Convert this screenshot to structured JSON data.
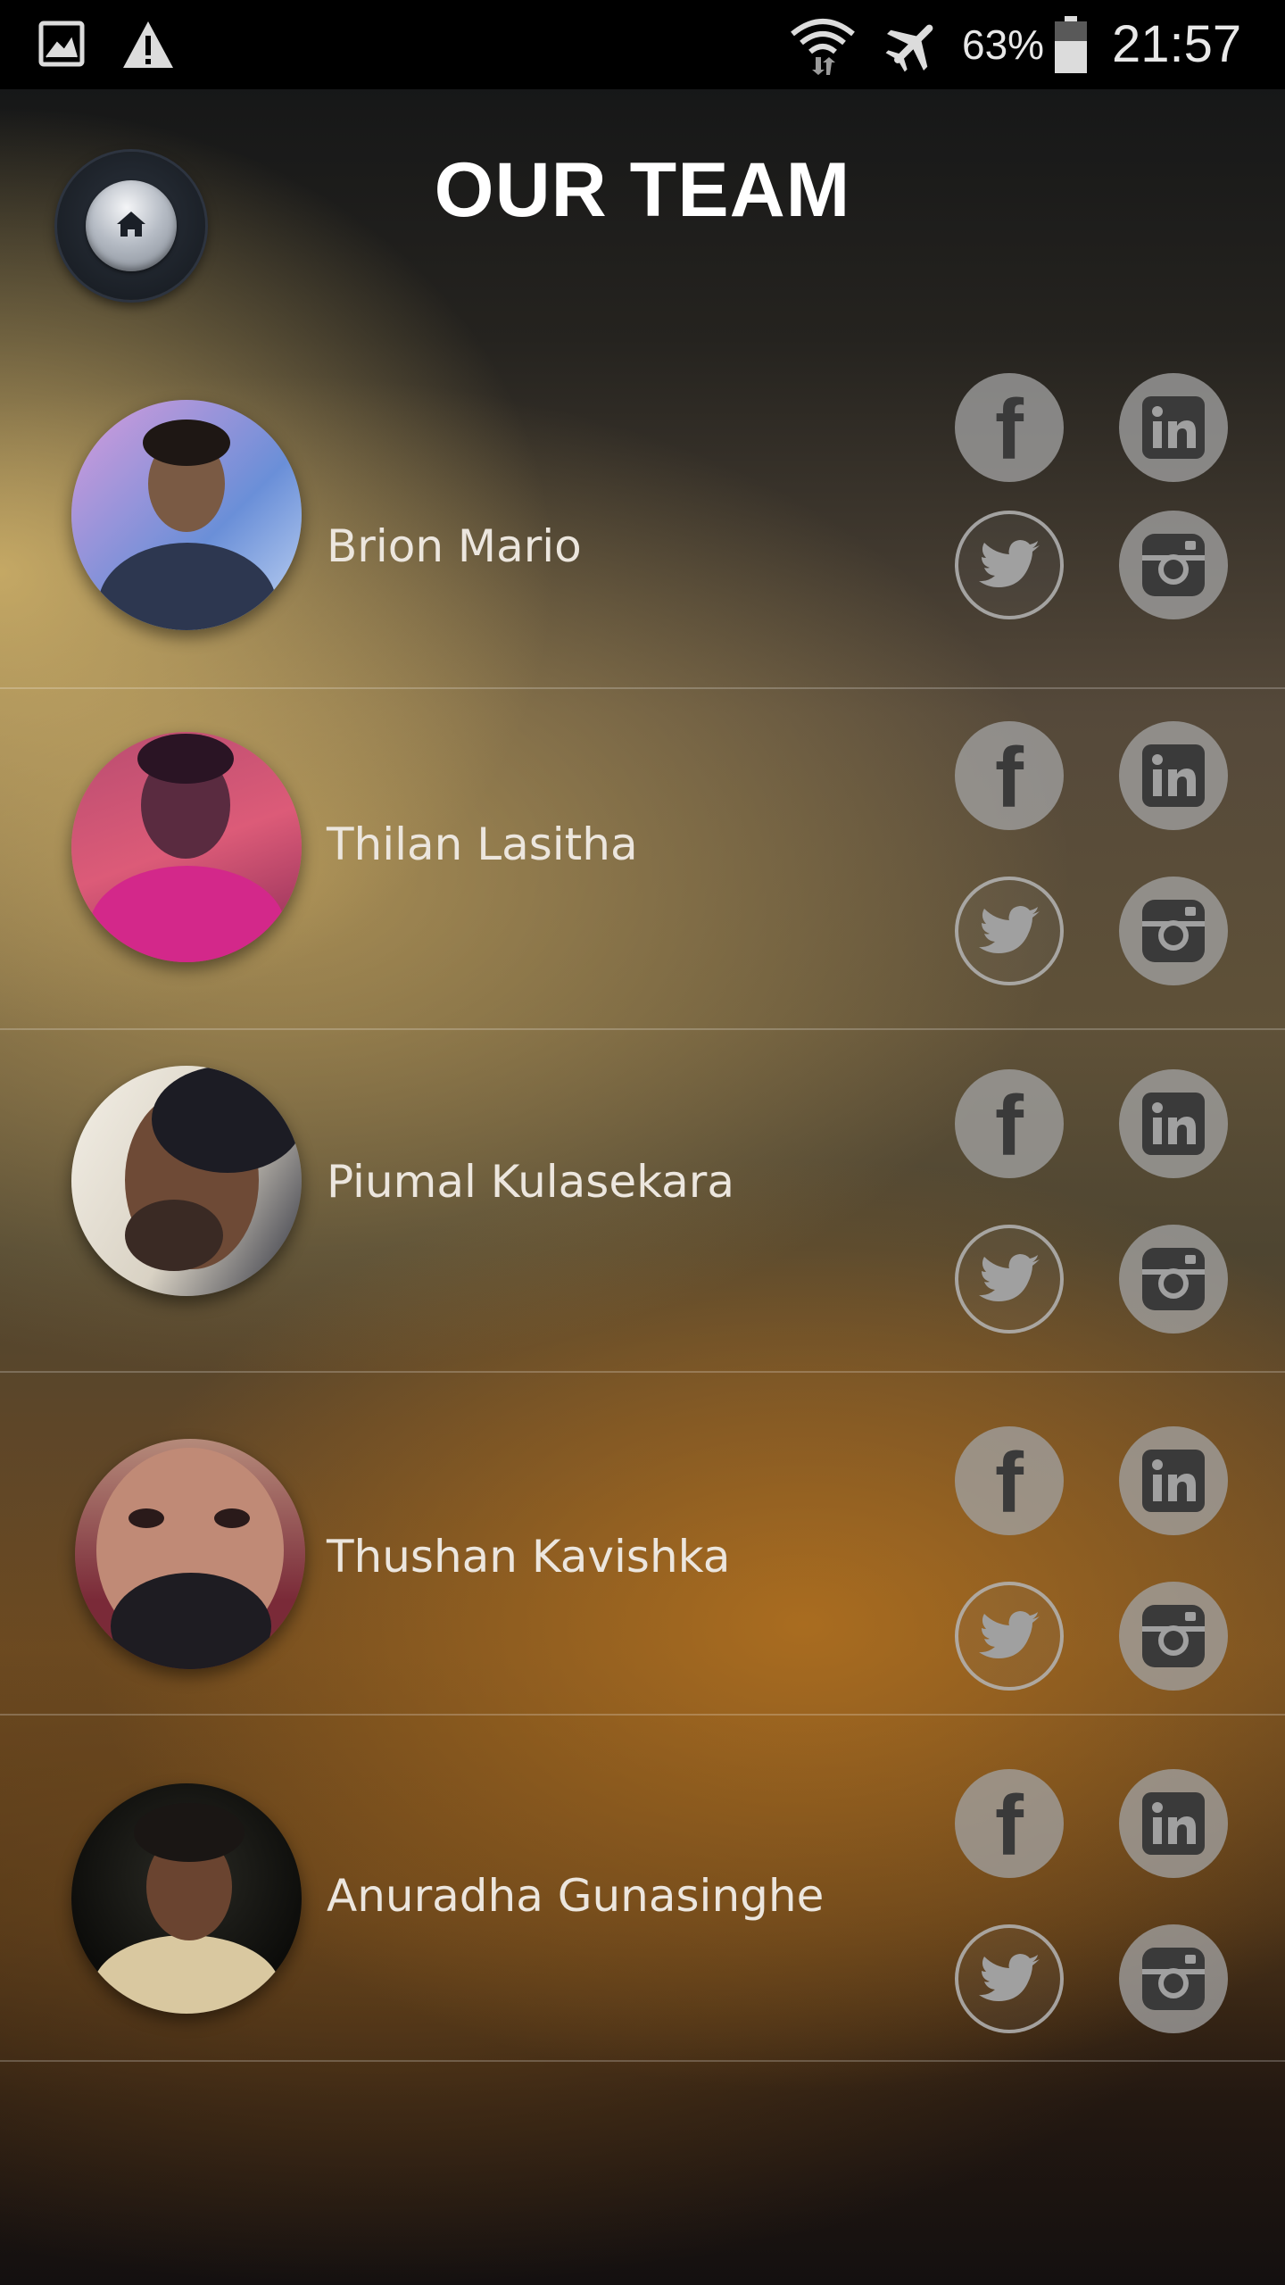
{
  "status_bar": {
    "battery_percent": "63%",
    "time": "21:57",
    "icons": [
      "gallery-icon",
      "warning-icon",
      "wifi-icon",
      "airplane-mode-icon",
      "battery-icon"
    ]
  },
  "header": {
    "title": "OUR TEAM",
    "home_icon": "home-icon"
  },
  "team": [
    {
      "name": "Brion Mario",
      "social": [
        "facebook-icon",
        "linkedin-icon",
        "twitter-icon",
        "instagram-icon"
      ],
      "avatar_colors": [
        "#c98fd0",
        "#3a2a22",
        "#2d3750"
      ]
    },
    {
      "name": "Thilan Lasitha",
      "social": [
        "facebook-icon",
        "linkedin-icon",
        "twitter-icon",
        "instagram-icon"
      ],
      "avatar_colors": [
        "#c2446c",
        "#3a1c2e",
        "#d3288a"
      ]
    },
    {
      "name": "Piumal Kulasekara",
      "social": [
        "facebook-icon",
        "linkedin-icon",
        "twitter-icon",
        "instagram-icon"
      ],
      "avatar_colors": [
        "#e9e2d6",
        "#6e4a36",
        "#2a2a3a"
      ]
    },
    {
      "name": "Thushan Kavishka",
      "social": [
        "facebook-icon",
        "linkedin-icon",
        "twitter-icon",
        "instagram-icon"
      ],
      "avatar_colors": [
        "#7a2a38",
        "#c08a76",
        "#1e1c22"
      ]
    },
    {
      "name": "Anuradha Gunasinghe",
      "social": [
        "facebook-icon",
        "linkedin-icon",
        "twitter-icon",
        "instagram-icon"
      ],
      "avatar_colors": [
        "#121210",
        "#6a4430",
        "#d9c8a0"
      ]
    }
  ],
  "colors": {
    "status_bar_bg": "#000000",
    "social_icon_fill": "#a0a0a0",
    "name_text": "#ece6de"
  }
}
